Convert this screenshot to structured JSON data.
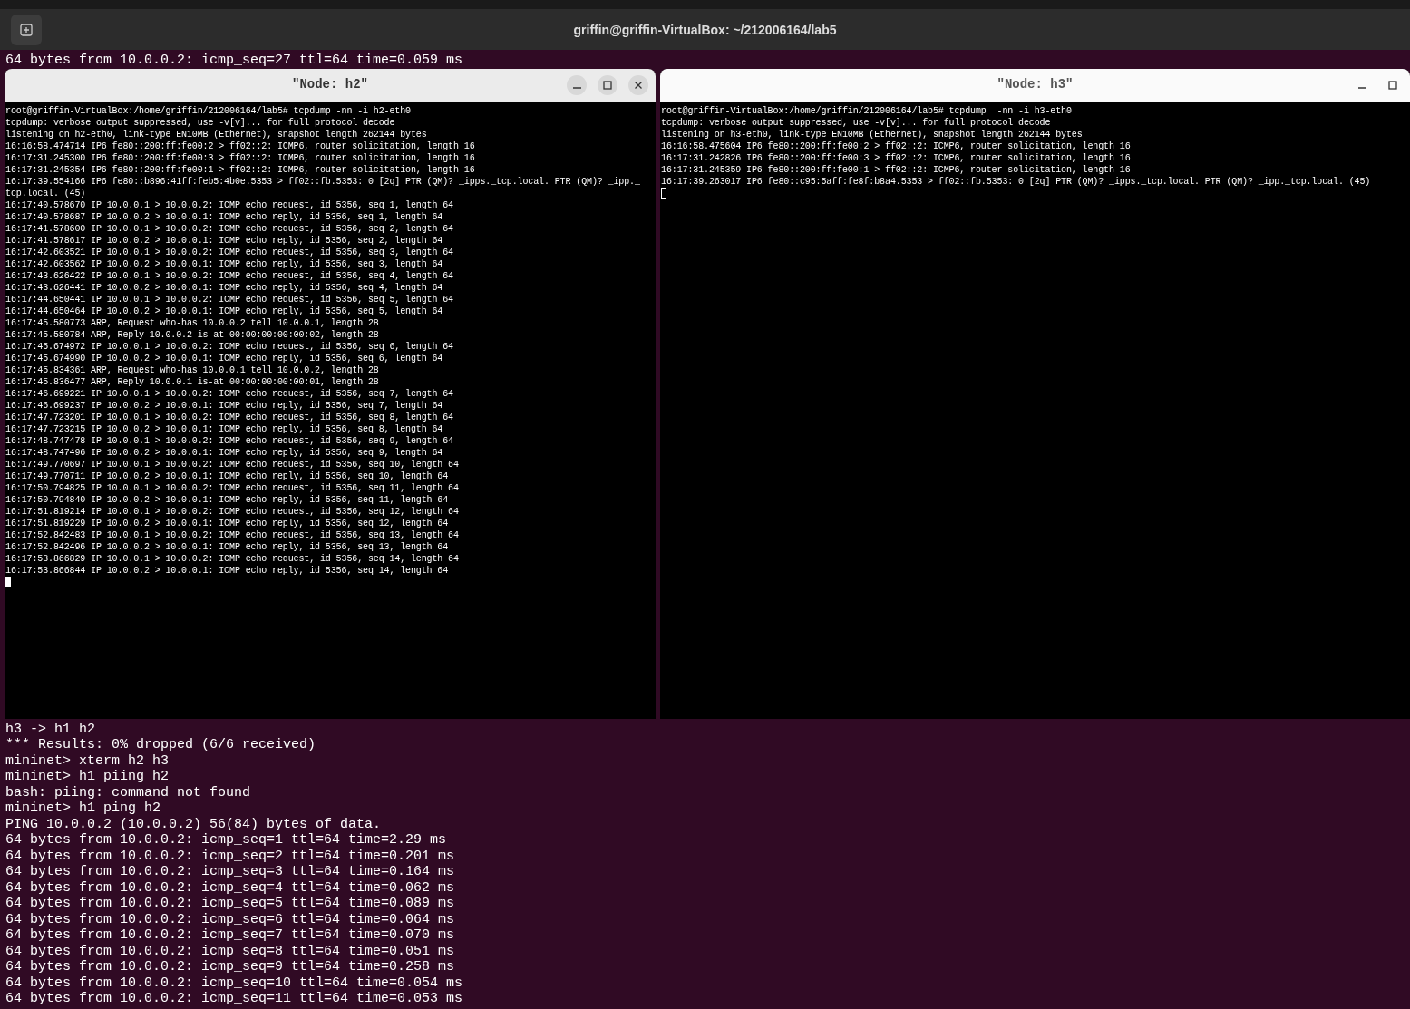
{
  "topbar": {
    "title": "griffin@griffin-VirtualBox: ~/212006164/lab5"
  },
  "terminal_top_lines": [
    "64 bytes from 10.0.0.2: icmp_seq=27 ttl=64 time=0.059 ms"
  ],
  "windows": [
    {
      "title": "\"Node: h2\"",
      "focused": true,
      "lines": [
        "root@griffin-VirtualBox:/home/griffin/212006164/lab5# tcpdump -nn -i h2-eth0",
        "tcpdump: verbose output suppressed, use -v[v]... for full protocol decode",
        "listening on h2-eth0, link-type EN10MB (Ethernet), snapshot length 262144 bytes",
        "16:16:58.474714 IP6 fe80::200:ff:fe00:2 > ff02::2: ICMP6, router solicitation, length 16",
        "16:17:31.245300 IP6 fe80::200:ff:fe00:3 > ff02::2: ICMP6, router solicitation, length 16",
        "16:17:31.245354 IP6 fe80::200:ff:fe00:1 > ff02::2: ICMP6, router solicitation, length 16",
        "16:17:39.554166 IP6 fe80::b896:41ff:feb5:4b0e.5353 > ff02::fb.5353: 0 [2q] PTR (QM)? _ipps._tcp.local. PTR (QM)? _ipp._",
        "tcp.local. (45)",
        "16:17:40.578670 IP 10.0.0.1 > 10.0.0.2: ICMP echo request, id 5356, seq 1, length 64",
        "16:17:40.578687 IP 10.0.0.2 > 10.0.0.1: ICMP echo reply, id 5356, seq 1, length 64",
        "16:17:41.578600 IP 10.0.0.1 > 10.0.0.2: ICMP echo request, id 5356, seq 2, length 64",
        "16:17:41.578617 IP 10.0.0.2 > 10.0.0.1: ICMP echo reply, id 5356, seq 2, length 64",
        "16:17:42.603521 IP 10.0.0.1 > 10.0.0.2: ICMP echo request, id 5356, seq 3, length 64",
        "16:17:42.603562 IP 10.0.0.2 > 10.0.0.1: ICMP echo reply, id 5356, seq 3, length 64",
        "16:17:43.626422 IP 10.0.0.1 > 10.0.0.2: ICMP echo request, id 5356, seq 4, length 64",
        "16:17:43.626441 IP 10.0.0.2 > 10.0.0.1: ICMP echo reply, id 5356, seq 4, length 64",
        "16:17:44.650441 IP 10.0.0.1 > 10.0.0.2: ICMP echo request, id 5356, seq 5, length 64",
        "16:17:44.650464 IP 10.0.0.2 > 10.0.0.1: ICMP echo reply, id 5356, seq 5, length 64",
        "16:17:45.580773 ARP, Request who-has 10.0.0.2 tell 10.0.0.1, length 28",
        "16:17:45.580784 ARP, Reply 10.0.0.2 is-at 00:00:00:00:00:02, length 28",
        "16:17:45.674972 IP 10.0.0.1 > 10.0.0.2: ICMP echo request, id 5356, seq 6, length 64",
        "16:17:45.674990 IP 10.0.0.2 > 10.0.0.1: ICMP echo reply, id 5356, seq 6, length 64",
        "16:17:45.834361 ARP, Request who-has 10.0.0.1 tell 10.0.0.2, length 28",
        "16:17:45.836477 ARP, Reply 10.0.0.1 is-at 00:00:00:00:00:01, length 28",
        "16:17:46.699221 IP 10.0.0.1 > 10.0.0.2: ICMP echo request, id 5356, seq 7, length 64",
        "16:17:46.699237 IP 10.0.0.2 > 10.0.0.1: ICMP echo reply, id 5356, seq 7, length 64",
        "16:17:47.723201 IP 10.0.0.1 > 10.0.0.2: ICMP echo request, id 5356, seq 8, length 64",
        "16:17:47.723215 IP 10.0.0.2 > 10.0.0.1: ICMP echo reply, id 5356, seq 8, length 64",
        "16:17:48.747478 IP 10.0.0.1 > 10.0.0.2: ICMP echo request, id 5356, seq 9, length 64",
        "16:17:48.747496 IP 10.0.0.2 > 10.0.0.1: ICMP echo reply, id 5356, seq 9, length 64",
        "16:17:49.770697 IP 10.0.0.1 > 10.0.0.2: ICMP echo request, id 5356, seq 10, length 64",
        "16:17:49.770711 IP 10.0.0.2 > 10.0.0.1: ICMP echo reply, id 5356, seq 10, length 64",
        "16:17:50.794825 IP 10.0.0.1 > 10.0.0.2: ICMP echo request, id 5356, seq 11, length 64",
        "16:17:50.794840 IP 10.0.0.2 > 10.0.0.1: ICMP echo reply, id 5356, seq 11, length 64",
        "16:17:51.819214 IP 10.0.0.1 > 10.0.0.2: ICMP echo request, id 5356, seq 12, length 64",
        "16:17:51.819229 IP 10.0.0.2 > 10.0.0.1: ICMP echo reply, id 5356, seq 12, length 64",
        "16:17:52.842483 IP 10.0.0.1 > 10.0.0.2: ICMP echo request, id 5356, seq 13, length 64",
        "16:17:52.842496 IP 10.0.0.2 > 10.0.0.1: ICMP echo reply, id 5356, seq 13, length 64",
        "16:17:53.866829 IP 10.0.0.1 > 10.0.0.2: ICMP echo request, id 5356, seq 14, length 64",
        "16:17:53.866844 IP 10.0.0.2 > 10.0.0.1: ICMP echo reply, id 5356, seq 14, length 64"
      ]
    },
    {
      "title": "\"Node: h3\"",
      "focused": false,
      "lines": [
        "root@griffin-VirtualBox:/home/griffin/212006164/lab5# tcpdump  -nn -i h3-eth0",
        "tcpdump: verbose output suppressed, use -v[v]... for full protocol decode",
        "listening on h3-eth0, link-type EN10MB (Ethernet), snapshot length 262144 bytes",
        "16:16:58.475604 IP6 fe80::200:ff:fe00:2 > ff02::2: ICMP6, router solicitation, length 16",
        "16:17:31.242826 IP6 fe80::200:ff:fe00:3 > ff02::2: ICMP6, router solicitation, length 16",
        "16:17:31.245359 IP6 fe80::200:ff:fe00:1 > ff02::2: ICMP6, router solicitation, length 16",
        "16:17:39.263017 IP6 fe80::c95:5aff:fe8f:b8a4.5353 > ff02::fb.5353: 0 [2q] PTR (QM)? _ipps._tcp.local. PTR (QM)? _ipp._tcp.local. (45)"
      ]
    }
  ],
  "terminal_lines": [
    "h3 -> h1 h2",
    "*** Results: 0% dropped (6/6 received)",
    "mininet> xterm h2 h3",
    "mininet> h1 piing h2",
    "bash: piing: command not found",
    "mininet> h1 ping h2",
    "PING 10.0.0.2 (10.0.0.2) 56(84) bytes of data.",
    "64 bytes from 10.0.0.2: icmp_seq=1 ttl=64 time=2.29 ms",
    "64 bytes from 10.0.0.2: icmp_seq=2 ttl=64 time=0.201 ms",
    "64 bytes from 10.0.0.2: icmp_seq=3 ttl=64 time=0.164 ms",
    "64 bytes from 10.0.0.2: icmp_seq=4 ttl=64 time=0.062 ms",
    "64 bytes from 10.0.0.2: icmp_seq=5 ttl=64 time=0.089 ms",
    "64 bytes from 10.0.0.2: icmp_seq=6 ttl=64 time=0.064 ms",
    "64 bytes from 10.0.0.2: icmp_seq=7 ttl=64 time=0.070 ms",
    "64 bytes from 10.0.0.2: icmp_seq=8 ttl=64 time=0.051 ms",
    "64 bytes from 10.0.0.2: icmp_seq=9 ttl=64 time=0.258 ms",
    "64 bytes from 10.0.0.2: icmp_seq=10 ttl=64 time=0.054 ms",
    "64 bytes from 10.0.0.2: icmp_seq=11 ttl=64 time=0.053 ms"
  ]
}
